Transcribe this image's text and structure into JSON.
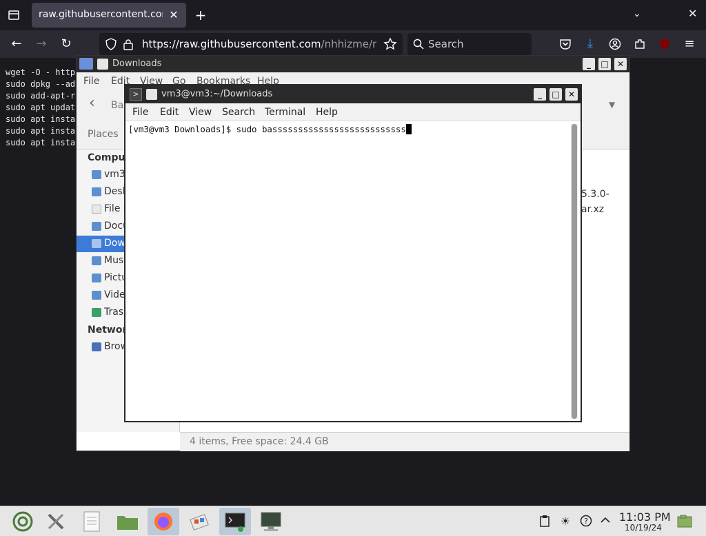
{
  "browser": {
    "tab_title": "raw.githubusercontent.com/",
    "url_host": "https://raw.githubusercontent.com",
    "url_path": "/nhhizme/nhh",
    "search_placeholder": "Search",
    "close_glyph": "✕",
    "newtab_glyph": "+",
    "chevron_glyph": "⌄"
  },
  "background_terminal": {
    "lines": [
      "wget -O - http",
      "sudo dpkg --ad",
      "sudo add-apt-r",
      "sudo apt updat",
      "sudo apt insta",
      "sudo apt insta",
      "sudo apt insta"
    ]
  },
  "file_manager": {
    "title": "Downloads",
    "menu": [
      "File",
      "Edit",
      "View",
      "Go",
      "Bookmarks",
      "Help"
    ],
    "back_label": "Ba",
    "places_label": "Places",
    "computer_heading": "Comput",
    "network_heading": "Networ",
    "items": [
      {
        "label": "vm3",
        "icon": "home-folder-icon"
      },
      {
        "label": "Desk",
        "icon": "desktop-folder-icon"
      },
      {
        "label": "File S",
        "icon": "filesystem-icon"
      },
      {
        "label": "Docu",
        "icon": "documents-folder-icon"
      },
      {
        "label": "Dow",
        "icon": "downloads-folder-icon"
      },
      {
        "label": "Mus",
        "icon": "music-folder-icon"
      },
      {
        "label": "Pictu",
        "icon": "pictures-folder-icon"
      },
      {
        "label": "Vide",
        "icon": "videos-folder-icon"
      },
      {
        "label": "Tras",
        "icon": "trash-icon"
      }
    ],
    "network_item": "Brow",
    "file_label_line1": "5.3.0-",
    "file_label_line2": "ar.xz",
    "status": "4 items, Free space: 24.4 GB"
  },
  "terminal": {
    "title": "vm3@vm3:~/Downloads",
    "menu": [
      "File",
      "Edit",
      "View",
      "Search",
      "Terminal",
      "Help"
    ],
    "prompt_line": "[vm3@vm3 Downloads]$ sudo bassssssssssssssssssssssssss"
  },
  "taskbar": {
    "clock_time": "11:03 PM",
    "clock_date": "10/19/24"
  }
}
